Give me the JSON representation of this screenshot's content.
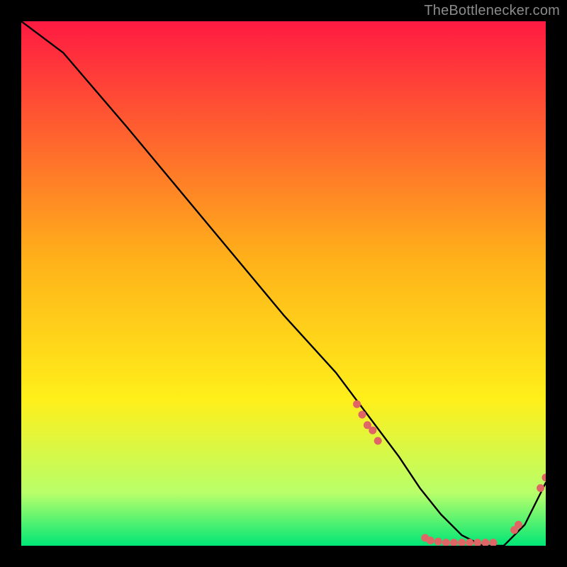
{
  "attribution": "TheBottlenecker.com",
  "colors": {
    "background_black": "#000000",
    "grad_red": "#ff1a42",
    "grad_orange": "#ffb01a",
    "grad_yellow": "#ffef1a",
    "grad_green_light": "#b8ff6a",
    "grad_green": "#00e676",
    "curve": "#000000",
    "dot": "#e06666"
  },
  "chart_data": {
    "type": "line",
    "title": "",
    "xlabel": "",
    "ylabel": "",
    "xlim": [
      0,
      100
    ],
    "ylim": [
      0,
      100
    ],
    "series": [
      {
        "name": "curve",
        "x": [
          0,
          8,
          20,
          30,
          40,
          50,
          60,
          66,
          72,
          76,
          80,
          84,
          88,
          92,
          96,
          100
        ],
        "y": [
          100,
          94,
          80,
          68,
          56,
          44,
          33,
          25,
          17,
          11,
          6,
          2,
          0,
          0,
          4,
          12
        ]
      }
    ],
    "dots": [
      {
        "x": 64,
        "y": 27
      },
      {
        "x": 65,
        "y": 25
      },
      {
        "x": 66,
        "y": 23
      },
      {
        "x": 67,
        "y": 22
      },
      {
        "x": 68,
        "y": 20
      },
      {
        "x": 77,
        "y": 1.5
      },
      {
        "x": 78,
        "y": 1
      },
      {
        "x": 79.5,
        "y": 0.8
      },
      {
        "x": 81,
        "y": 0.6
      },
      {
        "x": 82.5,
        "y": 0.6
      },
      {
        "x": 84,
        "y": 0.6
      },
      {
        "x": 85.5,
        "y": 0.6
      },
      {
        "x": 87,
        "y": 0.6
      },
      {
        "x": 88.5,
        "y": 0.6
      },
      {
        "x": 90,
        "y": 0.6
      },
      {
        "x": 94,
        "y": 3
      },
      {
        "x": 94.8,
        "y": 4
      },
      {
        "x": 99,
        "y": 11
      },
      {
        "x": 100,
        "y": 13
      }
    ]
  }
}
